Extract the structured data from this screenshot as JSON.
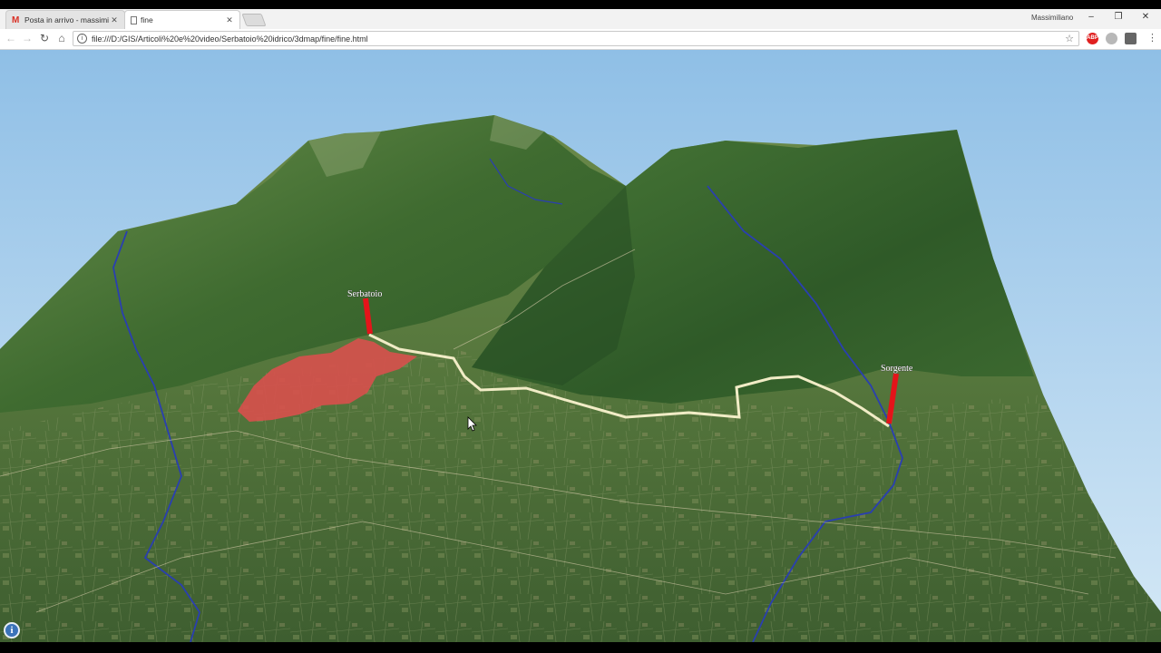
{
  "browser": {
    "tabs": [
      {
        "title": "Posta in arrivo - massimi",
        "icon": "gmail-icon"
      },
      {
        "title": "fine",
        "icon": "page-icon"
      }
    ],
    "profile_name": "Massimiliano",
    "window_controls": {
      "minimize": "–",
      "restore": "❐",
      "close": "✕"
    },
    "address": "file:///D:/GIS/Articoli%20e%20video/Serbatoio%20idrico/3dmap/fine/fine.html",
    "extensions": [
      {
        "icon": "abp-icon",
        "label": "ABP",
        "color": "#e02020"
      },
      {
        "icon": "cloud-icon",
        "label": "",
        "color": "#b8b8b8"
      },
      {
        "icon": "shield-icon",
        "label": "",
        "color": "#666666"
      }
    ]
  },
  "map": {
    "labels": {
      "reservoir": "Serbatoio",
      "spring": "Sorgente"
    },
    "colors": {
      "pipeline": "#f1ecc6",
      "river": "#2a3fb0",
      "town": "#d8504c",
      "marker": "#e4141a"
    },
    "info_button": "i"
  }
}
